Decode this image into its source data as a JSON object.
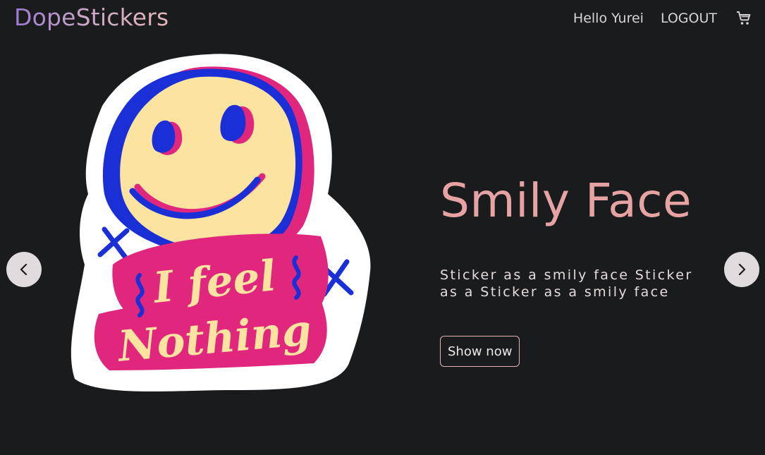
{
  "header": {
    "logo_text": "DopeStickers",
    "greeting": "Hello Yurei",
    "logout_label": "LOGOUT",
    "cart_icon": "shopping-cart-icon"
  },
  "carousel": {
    "prev_icon": "chevron-left-icon",
    "next_icon": "chevron-right-icon",
    "slide": {
      "title": "Smily Face",
      "description": "Sticker as a smily face Sticker as a Sticker as a smily face",
      "button_label": "Show now",
      "image": {
        "line1": "I feel",
        "line2": "Nothing"
      }
    }
  },
  "colors": {
    "background": "#1a1b1d",
    "title": "#e7a3a3",
    "logo_start": "#9c7bd3",
    "logo_end": "#e3b7b9",
    "sticker_pink": "#d81b73",
    "sticker_blue": "#1b2fd6",
    "sticker_cream": "#fde3a0"
  }
}
